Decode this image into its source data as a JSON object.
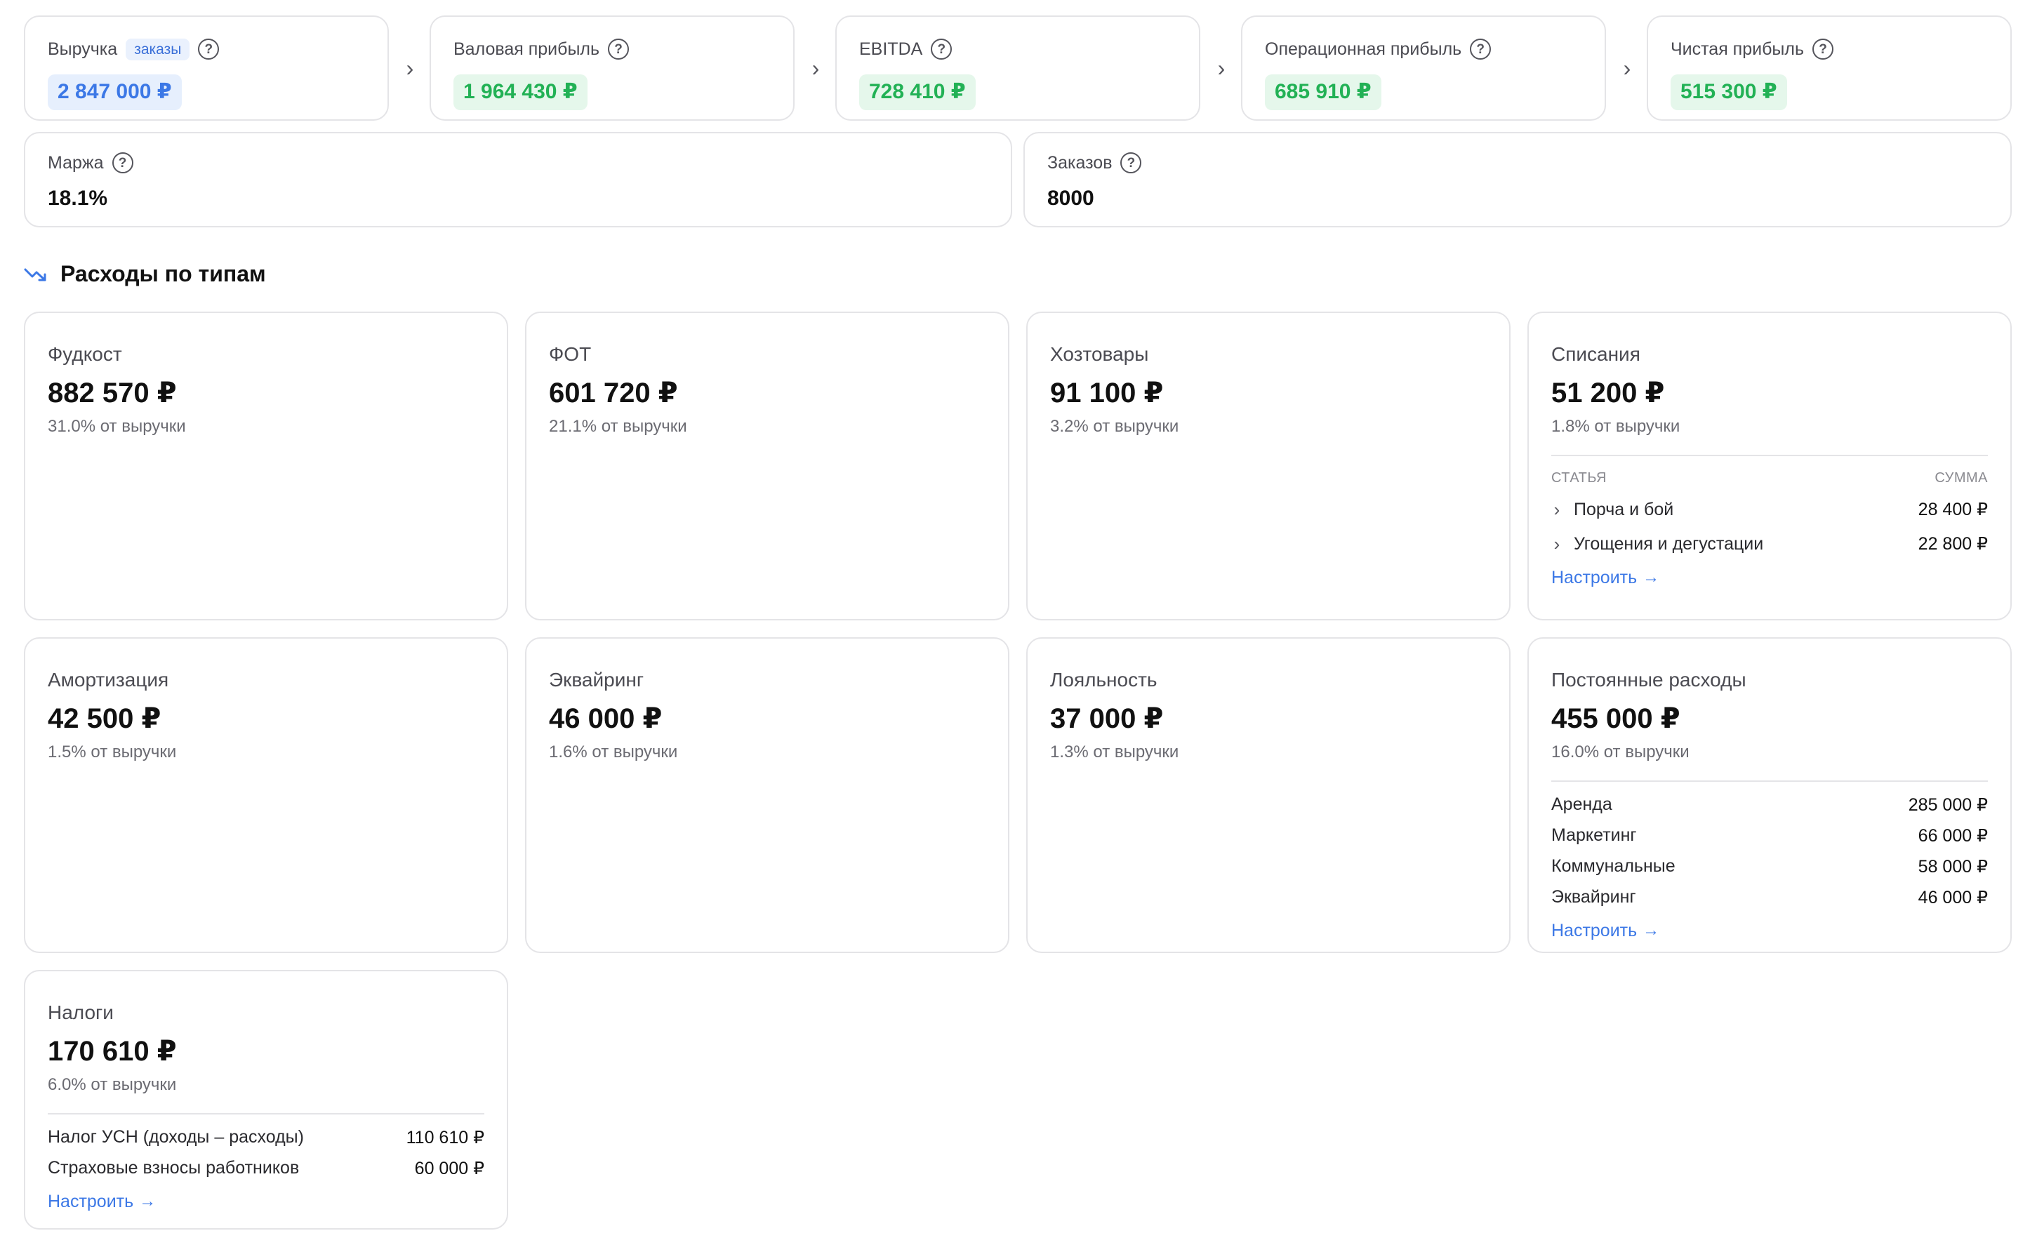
{
  "kpis": [
    {
      "label": "Выручка",
      "tag": "заказы",
      "value": "2 847 000 ₽",
      "color": "#3c78e6"
    },
    {
      "label": "Валовая прибыль",
      "value": "1 964 430 ₽",
      "color": "#22b155"
    },
    {
      "label": "EBITDA",
      "value": "728 410 ₽",
      "color": "#22b155"
    },
    {
      "label": "Операционная прибыль",
      "value": "685 910 ₽",
      "color": "#22b155"
    },
    {
      "label": "Чистая прибыль",
      "value": "515 300 ₽",
      "color": "#22b155"
    }
  ],
  "stats": {
    "margin": {
      "label": "Маржа",
      "value": "18.1%"
    },
    "orders": {
      "label": "Заказов",
      "value": "8000"
    }
  },
  "expenses_section": {
    "title": "Расходы по типам",
    "icon": "trend-down-icon"
  },
  "expenses": {
    "foodcost": {
      "name": "Фудкост",
      "value": "882 570 ₽",
      "share": "31.0% от выручки"
    },
    "payroll": {
      "name": "ФОТ",
      "value": "601 720 ₽",
      "share": "21.1% от выручки"
    },
    "supplies": {
      "name": "Хозтовары",
      "value": "91 100 ₽",
      "share": "3.2% от выручки"
    },
    "writeoffs": {
      "name": "Списания",
      "value": "51 200 ₽",
      "share": "1.8% от выручки",
      "col_item": "СТАТЬЯ",
      "col_amount": "СУММА",
      "items": [
        {
          "label": "Порча и бой",
          "amount": "28 400 ₽"
        },
        {
          "label": "Угощения и дегустации",
          "amount": "22 800 ₽"
        }
      ],
      "link": "Настроить"
    },
    "depreciation": {
      "name": "Амортизация",
      "value": "42 500 ₽",
      "share": "1.5% от выручки"
    },
    "acquiring": {
      "name": "Эквайринг",
      "value": "46 000 ₽",
      "share": "1.6% от выручки"
    },
    "loyalty": {
      "name": "Лояльность",
      "value": "37 000 ₽",
      "share": "1.3% от выручки"
    },
    "fixed": {
      "name": "Постоянные расходы",
      "value": "455 000 ₽",
      "share": "16.0% от выручки",
      "items": [
        {
          "label": "Аренда",
          "amount": "285 000 ₽"
        },
        {
          "label": "Маркетинг",
          "amount": "66 000 ₽"
        },
        {
          "label": "Коммунальные",
          "amount": "58 000 ₽"
        },
        {
          "label": "Эквайринг",
          "amount": "46 000 ₽"
        }
      ],
      "link": "Настроить"
    },
    "taxes": {
      "name": "Налоги",
      "value": "170 610 ₽",
      "share": "6.0% от выручки",
      "items": [
        {
          "label": "Налог УСН (доходы – расходы)",
          "amount": "110 610 ₽"
        },
        {
          "label": "Страховые взносы работников",
          "amount": "60 000 ₽"
        }
      ],
      "link": "Настроить"
    }
  }
}
